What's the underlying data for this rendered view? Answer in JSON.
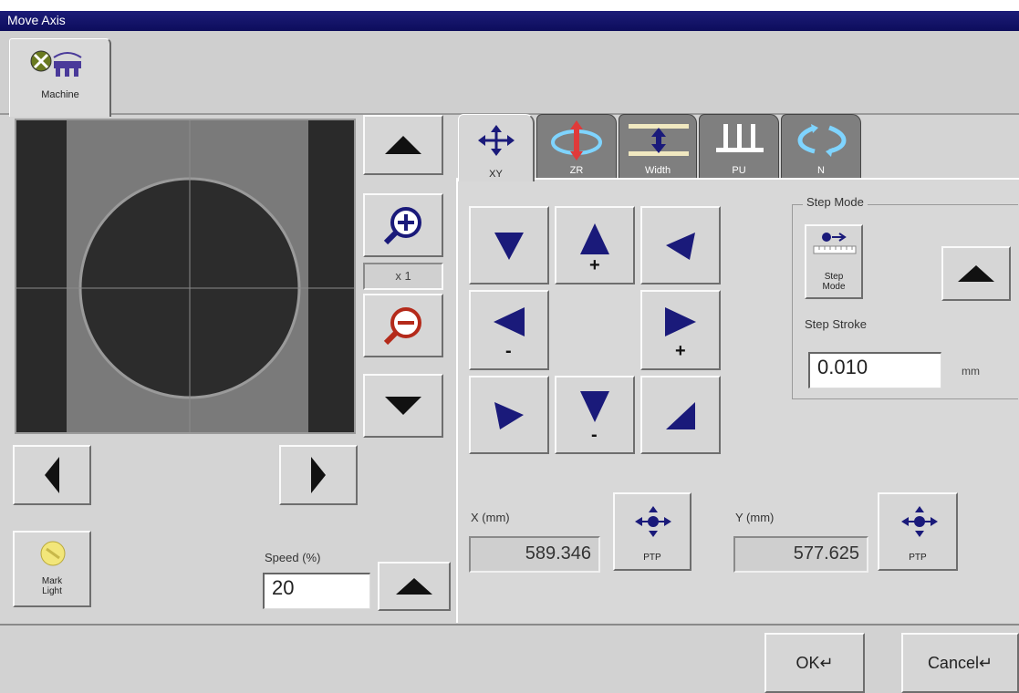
{
  "window": {
    "title": "Move Axis"
  },
  "machine_tab": {
    "label": "Machine"
  },
  "camera": {
    "zoom_label": "x 1"
  },
  "mark_light": {
    "label_line1": "Mark",
    "label_line2": "Light"
  },
  "speed": {
    "label": "Speed (%)",
    "value": "20"
  },
  "axis_tabs": [
    {
      "label": "XY"
    },
    {
      "label": "ZR"
    },
    {
      "label": "Width"
    },
    {
      "label": "PU"
    },
    {
      "label": "N"
    }
  ],
  "jog": {
    "plus": "+",
    "minus": "-"
  },
  "step_mode": {
    "group_label": "Step Mode",
    "button_line1": "Step",
    "button_line2": "Mode",
    "stroke_label": "Step Stroke",
    "stroke_value": "0.010",
    "unit": "mm"
  },
  "position": {
    "x_label": "X (mm)",
    "x_value": "589.346",
    "y_label": "Y (mm)",
    "y_value": "577.625",
    "ptp_label": "PTP"
  },
  "footer": {
    "ok_label": "OK↵",
    "cancel_label": "Cancel↵"
  },
  "colors": {
    "titlebar": "#0d0d5c",
    "arrow": "#1a1a7a",
    "panel": "#d4d4d4"
  }
}
